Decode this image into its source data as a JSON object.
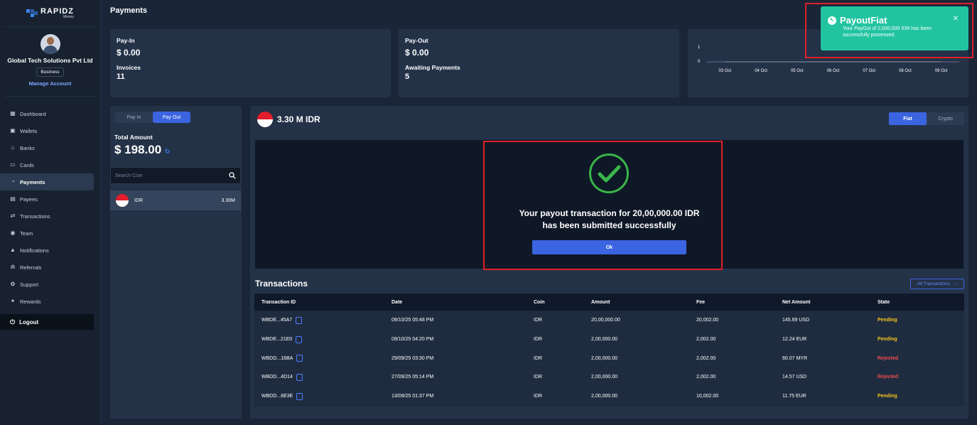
{
  "brand": {
    "name": "RAPIDZ",
    "sub": "Money"
  },
  "profile": {
    "company": "Global Tech Solutions Pvt Ltd",
    "type": "Business",
    "manage": "Manage Account"
  },
  "nav": [
    {
      "label": "Dashboard",
      "icon": "dashboard-icon"
    },
    {
      "label": "Wallets",
      "icon": "wallet-icon"
    },
    {
      "label": "Banks",
      "icon": "bank-icon"
    },
    {
      "label": "Cards",
      "icon": "card-icon"
    },
    {
      "label": "Payments",
      "icon": "payments-icon"
    },
    {
      "label": "Payees",
      "icon": "payees-icon"
    },
    {
      "label": "Transactions",
      "icon": "transactions-icon"
    },
    {
      "label": "Team",
      "icon": "team-icon"
    },
    {
      "label": "Notifications",
      "icon": "bell-icon"
    },
    {
      "label": "Referrals",
      "icon": "referrals-icon"
    },
    {
      "label": "Support",
      "icon": "support-icon"
    },
    {
      "label": "Rewards",
      "icon": "rewards-icon"
    }
  ],
  "logout": "Logout",
  "header": {
    "title": "Payments"
  },
  "payin": {
    "label": "Pay-In",
    "value": "$ 0.00",
    "sub_label": "Invoices",
    "sub_value": "11"
  },
  "payout": {
    "label": "Pay-Out",
    "value": "$ 0.00",
    "sub_label": "Awaiting Payments",
    "sub_value": "5"
  },
  "chart_data": {
    "type": "line",
    "x": [
      "03 Oct",
      "04 Oct",
      "05 Oct",
      "06 Oct",
      "07 Oct",
      "08 Oct",
      "09 Oct"
    ],
    "series": [
      {
        "values": [
          0,
          0,
          0,
          0,
          0,
          0,
          0
        ]
      }
    ],
    "yticks": [
      "1",
      "0"
    ],
    "ylim": [
      0,
      1
    ]
  },
  "left_panel": {
    "tab_payin": "Pay In",
    "tab_payout": "Pay Out",
    "total_label": "Total Amount",
    "total_value": "$ 198.00",
    "search_placeholder": "Search Coin",
    "coins": [
      {
        "code": "IDR",
        "amount": "3.30M"
      }
    ]
  },
  "main": {
    "balance": "3.30 M IDR",
    "seg_fiat": "Fiat",
    "seg_crypto": "Crypto",
    "success_line1": "Your payout transaction for 20,00,000.00 IDR",
    "success_line2": "has been submitted successfully",
    "ok": "Ok"
  },
  "transactions": {
    "title": "Transactions",
    "all_link": "All Transactions",
    "headers": [
      "Transaction ID",
      "Date",
      "Coin",
      "Amount",
      "Fee",
      "Net Amount",
      "State"
    ],
    "rows": [
      {
        "id": "WBDE...45A7",
        "date": "09/10/25 05:48 PM",
        "coin": "IDR",
        "amount": "20,00,000.00",
        "fee": "20,002.00",
        "net": "145.69 USD",
        "state": "Pending"
      },
      {
        "id": "WBDE...21E0",
        "date": "09/10/25 04:20 PM",
        "coin": "IDR",
        "amount": "2,00,000.00",
        "fee": "2,002.00",
        "net": "12.24 EUR",
        "state": "Pending"
      },
      {
        "id": "WBDD...16BA",
        "date": "29/09/25 03:30 PM",
        "coin": "IDR",
        "amount": "2,00,000.00",
        "fee": "2,002.00",
        "net": "60.07 MYR",
        "state": "Rejected"
      },
      {
        "id": "WBDD...4D14",
        "date": "27/09/25 05:14 PM",
        "coin": "IDR",
        "amount": "2,00,000.00",
        "fee": "2,002.00",
        "net": "14.57 USD",
        "state": "Rejected"
      },
      {
        "id": "WBDD...6E3E",
        "date": "13/09/25 01:37 PM",
        "coin": "IDR",
        "amount": "2,00,000.00",
        "fee": "10,002.00",
        "net": "11.75 EUR",
        "state": "Pending"
      }
    ]
  },
  "toast": {
    "title": "PayoutFiat",
    "body": "Your PayOut of 2,000,000 IDR has been successfully processed."
  },
  "colors": {
    "accent": "#3b64e0",
    "success": "#22c4a0",
    "pending": "#f5c518",
    "rejected": "#ef4b4b",
    "highlight": "#e0202a"
  }
}
